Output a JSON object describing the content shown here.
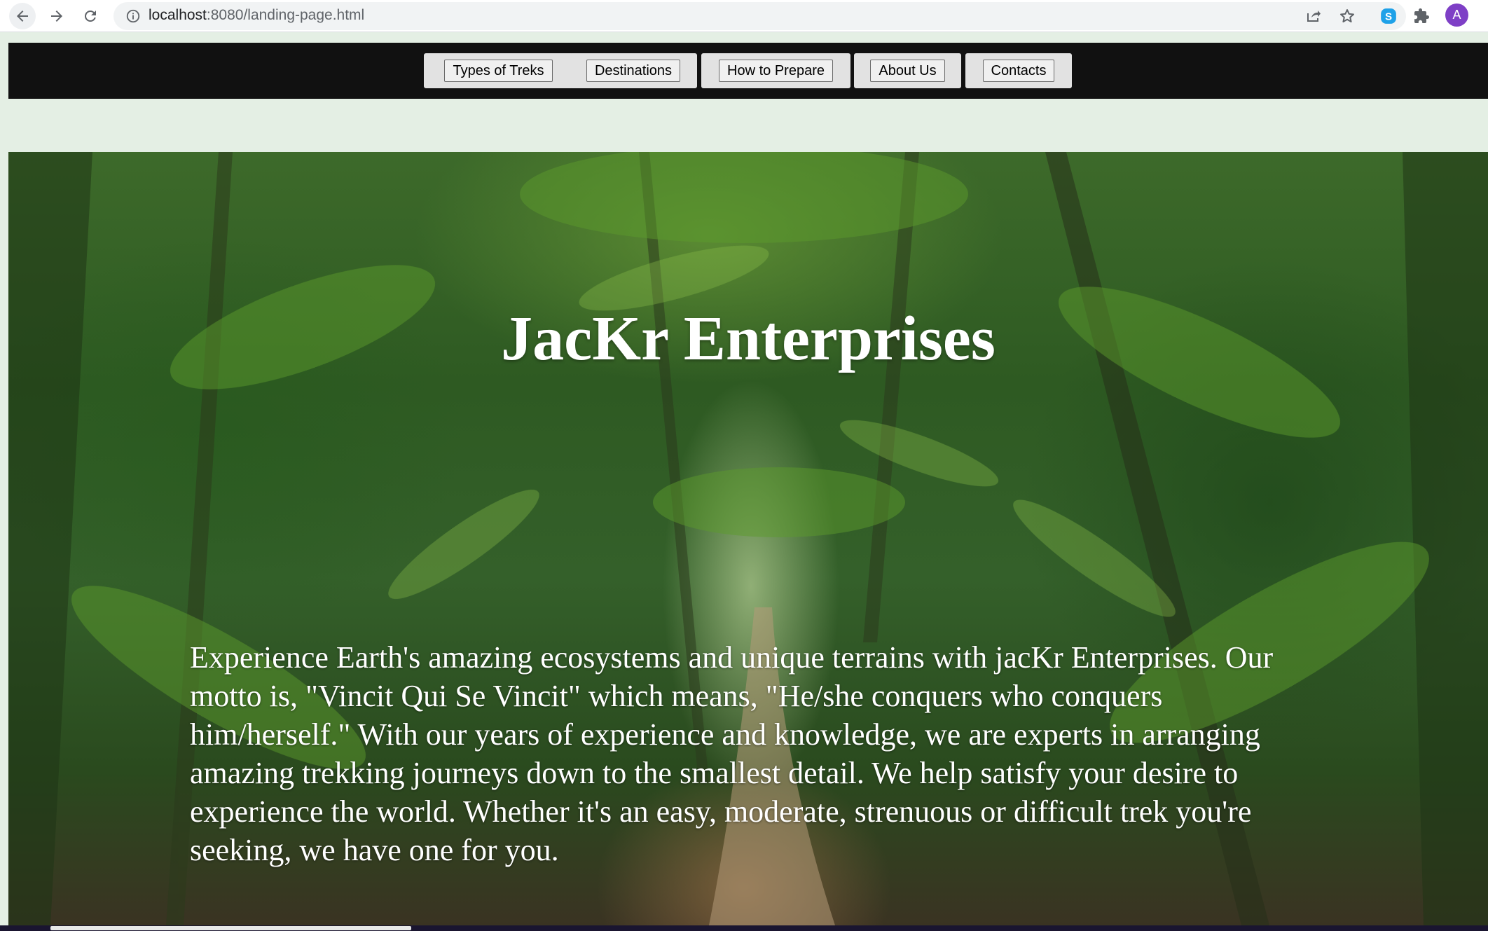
{
  "browser": {
    "url_host": "localhost",
    "url_rest": ":8080/landing-page.html",
    "avatar_initial": "A"
  },
  "site_nav": {
    "items": [
      {
        "label": "Types of Treks"
      },
      {
        "label": "Destinations"
      },
      {
        "label": "How to Prepare"
      },
      {
        "label": "About Us"
      },
      {
        "label": "Contacts"
      }
    ]
  },
  "hero": {
    "title": "JacKr Enterprises",
    "description": "Experience Earth's amazing ecosystems and unique terrains with jacKr Enterprises. Our motto is, \"Vincit Qui Se Vincit\" which means, \"He/she conquers who conquers him/herself.\" With our years of experience and knowledge, we are experts in arranging amazing trekking journeys down to the smallest detail. We help satisfy your desire to experience the world. Whether it's an easy, moderate, strenuous or difficult trek you're seeking, we have one for you."
  },
  "icons": {
    "back": "arrow-left-icon",
    "forward": "arrow-right-icon",
    "reload": "reload-icon",
    "info": "info-icon",
    "share": "share-icon",
    "star": "star-icon",
    "skype": "skype-icon",
    "extensions": "puzzle-icon"
  },
  "colors": {
    "nav_background": "#111111",
    "page_background": "#e4efe4",
    "avatar": "#7e3fc6"
  }
}
